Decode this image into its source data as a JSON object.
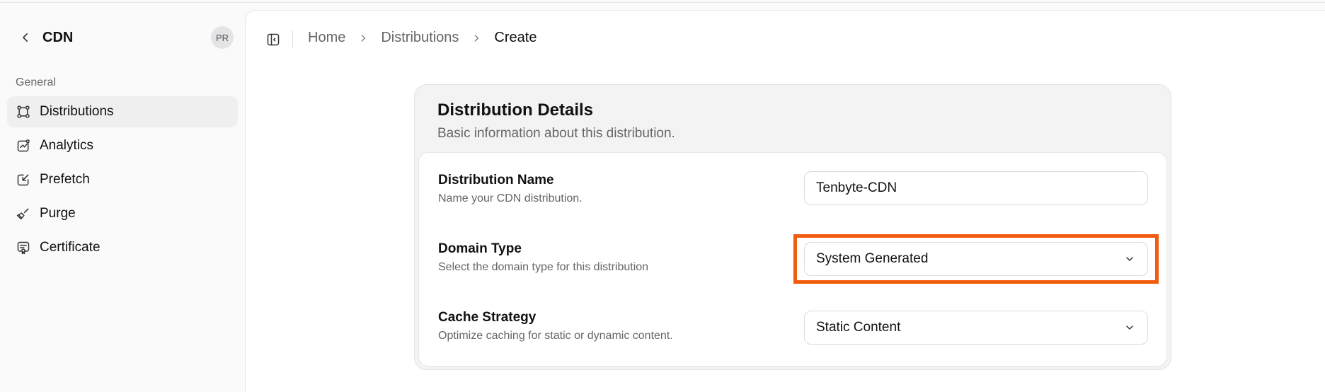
{
  "sidebar": {
    "title": "CDN",
    "avatar": "PR",
    "group_label": "General",
    "items": [
      {
        "label": "Distributions",
        "icon": "distributions-icon"
      },
      {
        "label": "Analytics",
        "icon": "analytics-icon"
      },
      {
        "label": "Prefetch",
        "icon": "prefetch-icon"
      },
      {
        "label": "Purge",
        "icon": "purge-icon"
      },
      {
        "label": "Certificate",
        "icon": "certificate-icon"
      }
    ]
  },
  "breadcrumb": {
    "items": [
      "Home",
      "Distributions",
      "Create"
    ]
  },
  "card": {
    "title": "Distribution Details",
    "subtitle": "Basic information about this distribution.",
    "fields": [
      {
        "label": "Distribution Name",
        "help": "Name your CDN distribution.",
        "value": "Tenbyte-CDN"
      },
      {
        "label": "Domain Type",
        "help": "Select the domain type for this distribution",
        "value": "System Generated"
      },
      {
        "label": "Cache Strategy",
        "help": "Optimize caching for static or dynamic content.",
        "value": "Static Content"
      }
    ]
  },
  "colors": {
    "highlight": "#f25c0d",
    "active_bg": "#efefef"
  }
}
